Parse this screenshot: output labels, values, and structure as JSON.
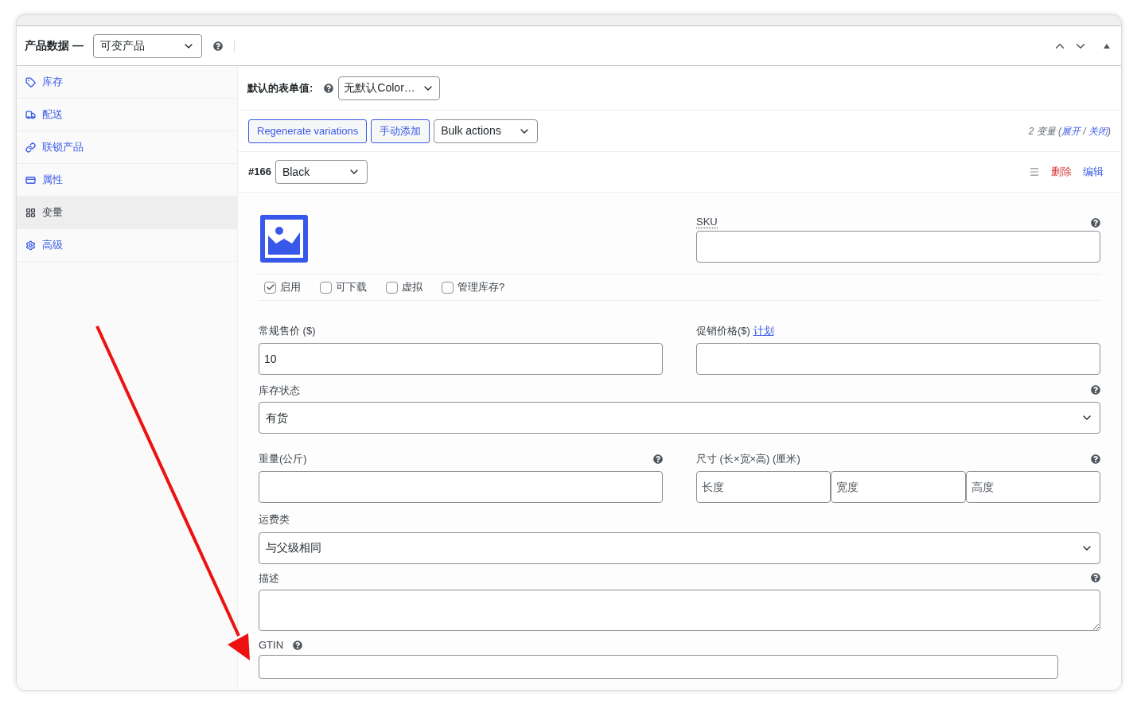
{
  "header": {
    "title": "产品数据 —",
    "product_type": "可变产品"
  },
  "sidebar": {
    "items": [
      {
        "kind": "tag",
        "label": "库存",
        "selected": false
      },
      {
        "kind": "truck",
        "label": "配送",
        "selected": false
      },
      {
        "kind": "link",
        "label": "联锁产品",
        "selected": false
      },
      {
        "kind": "list",
        "label": "属性",
        "selected": false
      },
      {
        "kind": "grid",
        "label": "变量",
        "selected": true
      },
      {
        "kind": "gear",
        "label": "高级",
        "selected": false
      }
    ]
  },
  "defaults": {
    "label": "默认的表单值:",
    "value": "无默认Color…"
  },
  "toolbar": {
    "buttons": [
      "Regenerate variations",
      "手动添加"
    ],
    "bulk_actions": "Bulk actions",
    "summary": {
      "prefix": "2 变量 (",
      "expand": "展开",
      "separator": " / ",
      "collapse": "关闭",
      "suffix": ")"
    }
  },
  "variation": {
    "id": "#166",
    "attribute": "Black",
    "delete": "删除",
    "edit": "编辑",
    "sku": {
      "label": "SKU"
    },
    "options": [
      {
        "label": "启用",
        "checked": true
      },
      {
        "label": "可下载",
        "checked": false
      },
      {
        "label": "虚拟",
        "checked": false
      },
      {
        "label": "管理库存?",
        "checked": false
      }
    ],
    "regular_price": {
      "label": "常规售价 ($)",
      "value": "10"
    },
    "sale_price": {
      "label": "促销价格($)",
      "link": "计划"
    },
    "stock_status": {
      "label": "库存状态",
      "value": "有货"
    },
    "weight": {
      "label": "重量(公斤)"
    },
    "dimensions": {
      "label": "尺寸 (长×宽×高) (厘米)",
      "fields": [
        {
          "placeholder": "长度"
        },
        {
          "placeholder": "宽度"
        },
        {
          "placeholder": "高度"
        }
      ]
    },
    "shipping_class": {
      "label": "运费类",
      "value": "与父级相同"
    },
    "description": {
      "label": "描述"
    },
    "gtin": {
      "label": "GTIN"
    }
  }
}
